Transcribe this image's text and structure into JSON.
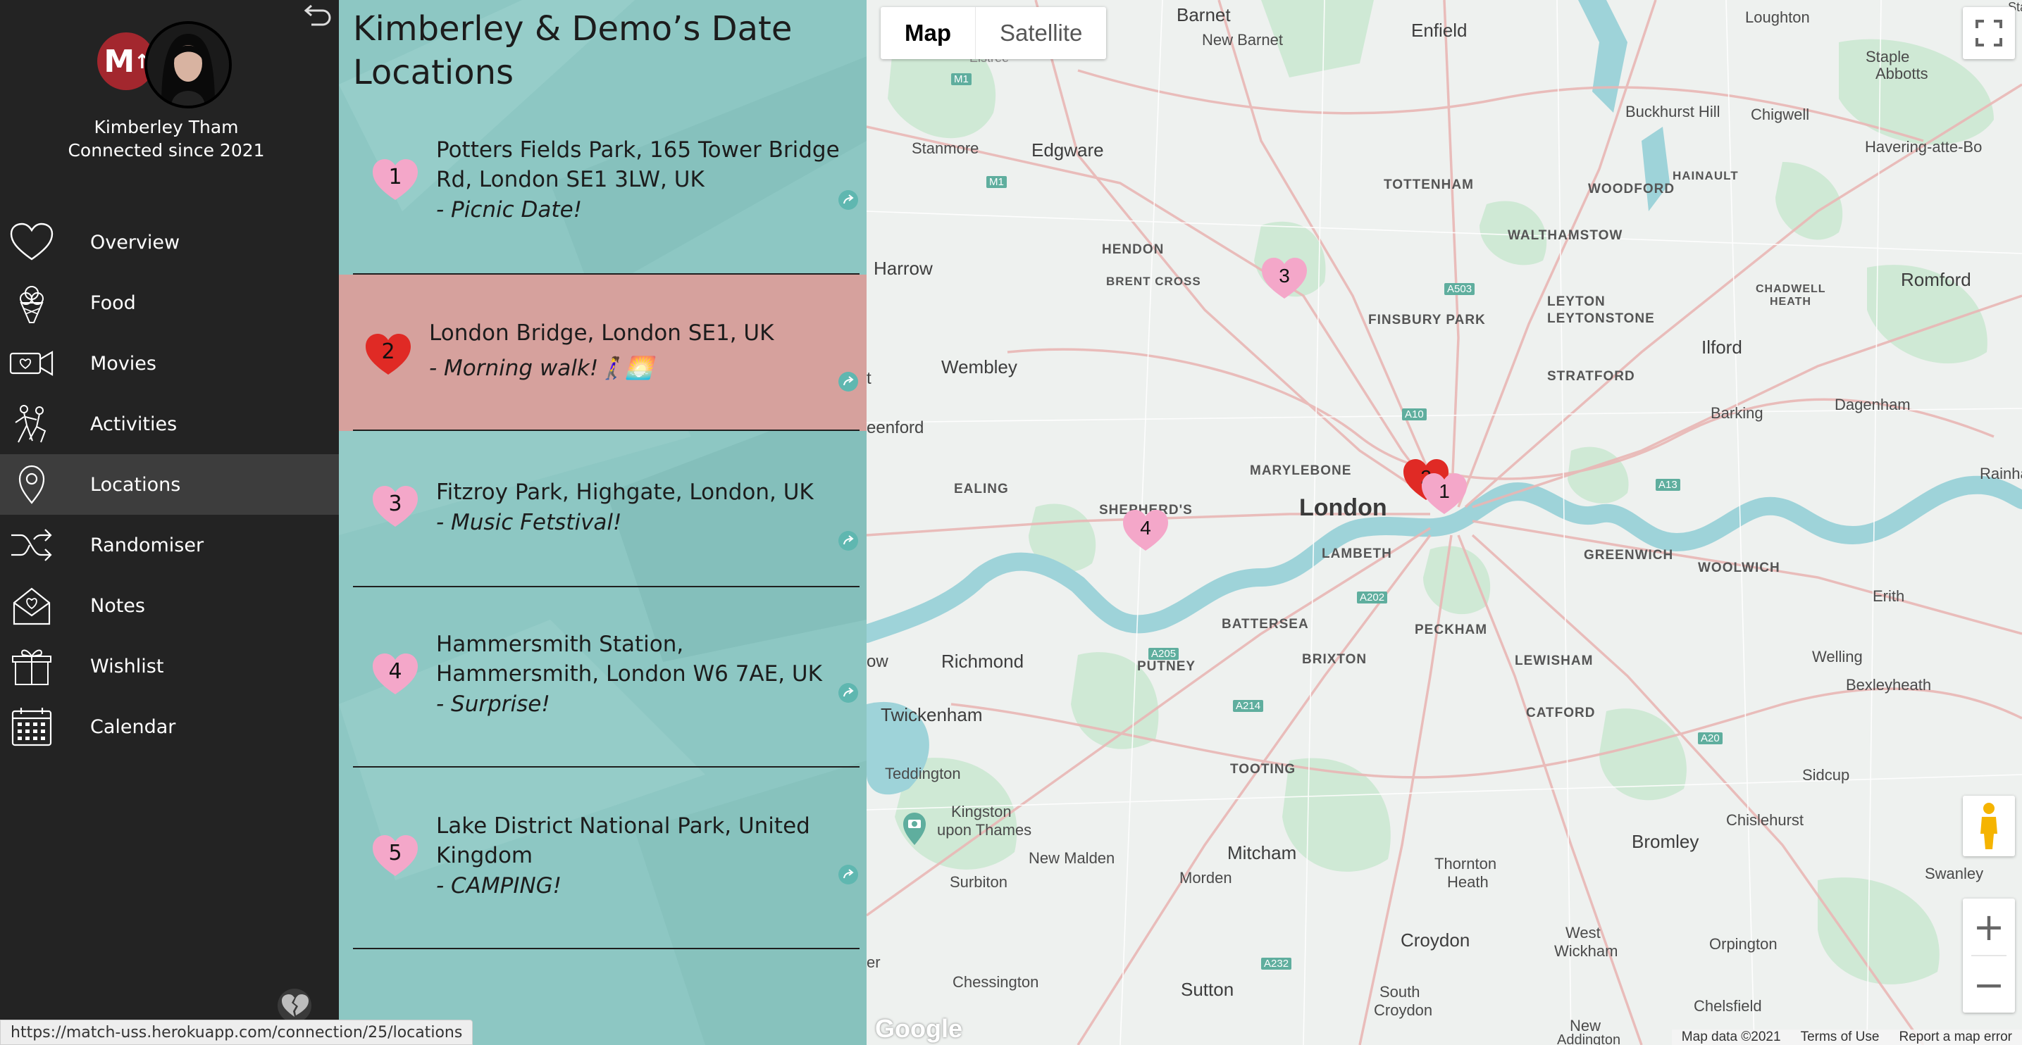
{
  "sidebar": {
    "logo_text": "M",
    "logo_arrow": "↑",
    "profile_name": "Kimberley Tham",
    "profile_sub": "Connected since 2021",
    "items": [
      {
        "label": "Overview",
        "icon": "heart-outline-icon"
      },
      {
        "label": "Food",
        "icon": "ice-cream-icon"
      },
      {
        "label": "Movies",
        "icon": "video-camera-icon"
      },
      {
        "label": "Activities",
        "icon": "dancing-couple-icon"
      },
      {
        "label": "Locations",
        "icon": "map-pin-icon",
        "active": true
      },
      {
        "label": "Randomiser",
        "icon": "shuffle-icon"
      },
      {
        "label": "Notes",
        "icon": "love-letter-icon"
      },
      {
        "label": "Wishlist",
        "icon": "gift-icon"
      },
      {
        "label": "Calendar",
        "icon": "calendar-icon"
      }
    ]
  },
  "status_url": "https://match-uss.herokuapp.com/connection/25/locations",
  "list": {
    "title": "Kimberley & Demo’s Date Locations",
    "locations": [
      {
        "num": "1",
        "address": "Potters Fields Park, 165 Tower Bridge Rd, London SE1 3LW, UK",
        "note": "- Picnic Date!"
      },
      {
        "num": "2",
        "address": "London Bridge, London SE1, UK",
        "note": "- Morning walk!🚶‍♀️🌅",
        "selected": true
      },
      {
        "num": "3",
        "address": "Fitzroy Park, Highgate, London, UK",
        "note": "- Music Fetstival!"
      },
      {
        "num": "4",
        "address": "Hammersmith Station, Hammersmith, London W6 7AE, UK",
        "note": "- Surprise!"
      },
      {
        "num": "5",
        "address": "Lake District National Park, United Kingdom",
        "note": "- CAMPING!"
      }
    ]
  },
  "map": {
    "type_buttons": [
      "Map",
      "Satellite"
    ],
    "zoom_in": "+",
    "zoom_out": "−",
    "logo": "Google",
    "attribution": [
      "Map data ©2021",
      "Terms of Use",
      "Report a map error"
    ],
    "markers": [
      {
        "num": "1",
        "color": "#f4a7c9"
      },
      {
        "num": "2",
        "color": "#e02a25"
      },
      {
        "num": "3",
        "color": "#f4a7c9"
      },
      {
        "num": "4",
        "color": "#f4a7c9"
      }
    ],
    "places": {
      "barnet": "Barnet",
      "new_barnet": "New Barnet",
      "enfield": "Enfield",
      "loughton": "Loughton",
      "stanmore": "Stanmore",
      "edgware": "Edgware",
      "tottenham": "TOTTENHAM",
      "buckhurst": "Buckhurst Hill",
      "chigwell": "Chigwell",
      "staple": "Staple",
      "abbotts": "Abbotts",
      "hainault": "HAINAULT",
      "havering": "Havering-atte-Bo",
      "woodford": "WOODFORD",
      "walthamstow": "WALTHAMSTOW",
      "hendon": "HENDON",
      "brent_cross": "BRENT CROSS",
      "harrow": "Harrow",
      "finsbury": "FINSBURY PARK",
      "leyton": "LEYTON",
      "leytonstone": "LEYTONSTONE",
      "chadwell": "CHADWELL",
      "heath": "HEATH",
      "romford": "Romford",
      "wembley": "Wembley",
      "ilford": "Ilford",
      "stratford": "STRATFORD",
      "greenford": "eenford",
      "barking": "Barking",
      "dagenham": "Dagenham",
      "marylebone": "MARYLEBONE",
      "ealing": "EALING",
      "shepherds": "SHEPHERD'S",
      "london": "London",
      "lambeth": "LAMBETH",
      "greenwich": "GREENWICH",
      "woolwich": "WOOLWICH",
      "erith": "Erith",
      "battersea": "BATTERSEA",
      "peckham": "PECKHAM",
      "richmond": "Richmond",
      "putney": "PUTNEY",
      "brixton": "BRIXTON",
      "lewisham": "LEWISHAM",
      "welling": "Welling",
      "bexleyheath": "Bexleyheath",
      "twickenham": "Twickenham",
      "catford": "CATFORD",
      "teddington": "Teddington",
      "tooting": "TOOTING",
      "sidcup": "Sidcup",
      "kingston": "Kingston",
      "upon_thames": "upon Thames",
      "new_malden": "New Malden",
      "mitcham": "Mitcham",
      "thornton": "Thornton",
      "heath2": "Heath",
      "bromley": "Bromley",
      "chislehurst": "Chislehurst",
      "morden": "Morden",
      "surbiton": "Surbiton",
      "west": "West",
      "wickham": "Wickham",
      "orpington": "Orpington",
      "swanley": "Swanley",
      "croydon": "Croydon",
      "chessington": "Chessington",
      "sutton": "Sutton",
      "south": "South",
      "croydon2": "Croydon",
      "chelsfield": "Chelsfield",
      "new2": "New",
      "addington": "Addington",
      "rainham": "Rainha",
      "elstree": "Elstree",
      "stanford": "Stanford",
      "t": "t",
      "ow": "ow",
      "er": "er"
    }
  }
}
